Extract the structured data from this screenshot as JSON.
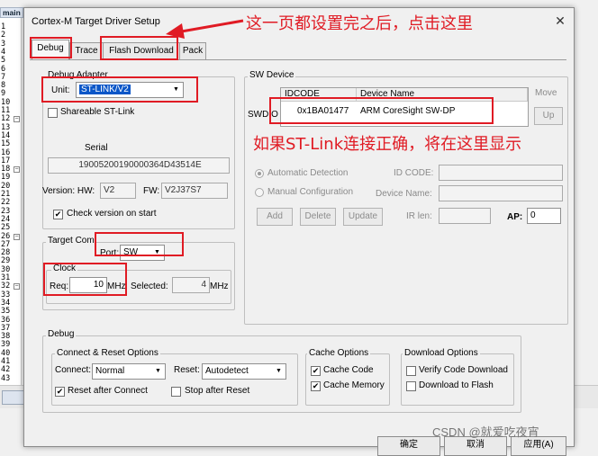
{
  "editor": {
    "tab_label": "main",
    "line_numbers": [
      "1",
      "2",
      "3",
      "4",
      "5",
      "6",
      "7",
      "8",
      "9",
      "10",
      "11",
      "12",
      "13",
      "14",
      "15",
      "16",
      "17",
      "18",
      "19",
      "20",
      "21",
      "22",
      "23",
      "24",
      "25",
      "26",
      "27",
      "28",
      "29",
      "30",
      "31",
      "32",
      "33",
      "34",
      "35",
      "36",
      "37",
      "38",
      "39",
      "40",
      "41",
      "42",
      "43"
    ],
    "fold_lines": [
      "12",
      "18",
      "26",
      "32"
    ],
    "fold_symbol": "−"
  },
  "dialog": {
    "title": "Cortex-M Target Driver Setup",
    "close_glyph": "✕",
    "tabs": [
      {
        "label": "Debug",
        "active": true
      },
      {
        "label": "Trace",
        "active": false
      },
      {
        "label": "Flash Download",
        "active": false
      },
      {
        "label": "Pack",
        "active": false
      }
    ]
  },
  "debug_adapter": {
    "group_label": "Debug Adapter",
    "unit_label": "Unit:",
    "unit_value": "ST-LINK/V2",
    "shareable_label": "Shareable ST-Link",
    "shareable_checked": false,
    "serial_label": "Serial",
    "serial_value": "19005200190000364D43514E",
    "hw_label": "Version: HW:",
    "hw_value": "V2",
    "fw_label": "FW:",
    "fw_value": "V2J37S7",
    "check_version_label": "Check version on start",
    "check_version_checked": true
  },
  "target_com": {
    "group_label": "Target Com",
    "port_label": "Port:",
    "port_value": "SW",
    "clock_label": "Clock",
    "req_label": "Req:",
    "req_value": "10",
    "req_unit": "MHz",
    "selected_label": "Selected:",
    "selected_value": "4",
    "selected_unit": "MHz"
  },
  "sw_device": {
    "group_label": "SW Device",
    "col_idcode": "IDCODE",
    "col_device_name": "Device Name",
    "row_prefix": "SWDIO",
    "row_idcode": "0x1BA01477",
    "row_device_name": "ARM CoreSight SW-DP",
    "move_label": "Move",
    "up_label": "Up",
    "auto_detect_label": "Automatic Detection",
    "manual_config_label": "Manual Configuration",
    "id_code_label": "ID CODE:",
    "device_name_label": "Device Name:",
    "add_label": "Add",
    "delete_label": "Delete",
    "update_label": "Update",
    "ir_len_label": "IR len:",
    "ap_label": "AP:",
    "ap_value": "0"
  },
  "debug": {
    "group_label": "Debug",
    "connect_reset_label": "Connect & Reset Options",
    "connect_label": "Connect:",
    "connect_value": "Normal",
    "reset_label": "Reset:",
    "reset_value": "Autodetect",
    "reset_after_connect_label": "Reset after Connect",
    "reset_after_connect_checked": true,
    "stop_after_reset_label": "Stop after Reset",
    "stop_after_reset_checked": false,
    "cache_options_label": "Cache Options",
    "cache_code_label": "Cache Code",
    "cache_code_checked": true,
    "cache_memory_label": "Cache Memory",
    "cache_memory_checked": true,
    "download_options_label": "Download Options",
    "verify_download_label": "Verify Code Download",
    "verify_download_checked": false,
    "download_flash_label": "Download to Flash",
    "download_flash_checked": false
  },
  "footer": {
    "ok_label": "确定",
    "cancel_label": "取消",
    "apply_label": "应用(A)"
  },
  "annotations": {
    "top_note": "这一页都设置完之后，点击这里",
    "middle_note": "如果ST-Link连接正确，将在这里显示",
    "watermark": "CSDN @就爱吃夜宵",
    "color": "#e01b24"
  },
  "icons": {
    "check": "✔",
    "dropdown": "▼"
  }
}
